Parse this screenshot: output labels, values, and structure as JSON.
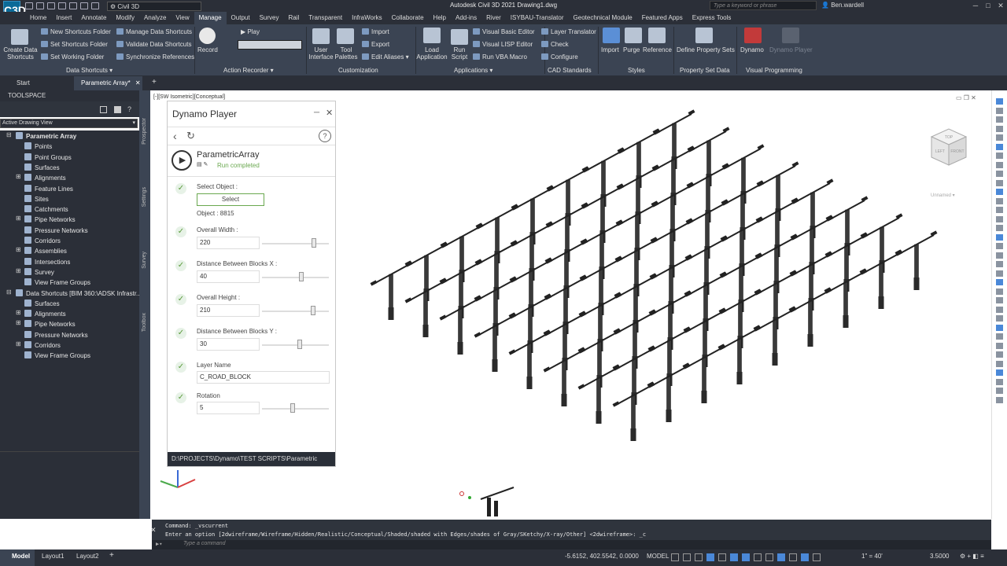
{
  "titlebar": {
    "logo": "C3D",
    "workspace": "Civil 3D",
    "title": "Autodesk Civil 3D 2021    Drawing1.dwg",
    "search_placeholder": "Type a keyword or phrase",
    "user": "Ben.wardell"
  },
  "menu_tabs": [
    "Home",
    "Insert",
    "Annotate",
    "Modify",
    "Analyze",
    "View",
    "Manage",
    "Output",
    "Survey",
    "Rail",
    "Transparent",
    "InfraWorks",
    "Collaborate",
    "Help",
    "Add-ins",
    "River",
    "ISYBAU-Translator",
    "Geotechnical Module",
    "Featured Apps",
    "Express Tools"
  ],
  "active_tab": "Manage",
  "ribbon": {
    "data_shortcuts": {
      "create": "Create Data Shortcuts",
      "items": [
        "New Shortcuts Folder",
        "Set Shortcuts Folder",
        "Set Working Folder",
        "Manage Data Shortcuts",
        "Validate Data Shortcuts",
        "Synchronize References"
      ],
      "label": "Data Shortcuts"
    },
    "action_recorder": {
      "record": "Record",
      "play": "Play",
      "label": "Action Recorder"
    },
    "customization": {
      "user_interface": "User Interface",
      "tool_palettes": "Tool Palettes",
      "import": "Import",
      "export": "Export",
      "edit_aliases": "Edit Aliases",
      "label": "Customization"
    },
    "applications": {
      "load": "Load Application",
      "run": "Run Script",
      "vb_editor": "Visual Basic Editor",
      "lisp_editor": "Visual LISP Editor",
      "vba_macro": "Run VBA Macro",
      "label": "Applications"
    },
    "cad_standards": {
      "layer_translator": "Layer Translator",
      "check": "Check",
      "configure": "Configure",
      "label": "CAD Standards"
    },
    "styles": {
      "import": "Import",
      "purge": "Purge",
      "reference": "Reference",
      "label": "Styles"
    },
    "property_set": {
      "define": "Define Property Sets",
      "label": "Property Set Data"
    },
    "visual_programming": {
      "dynamo": "Dynamo",
      "player": "Dynamo Player",
      "label": "Visual Programming"
    }
  },
  "doc_tabs": {
    "start": "Start",
    "current": "Parametric Array*"
  },
  "toolspace": {
    "header": "TOOLSPACE",
    "view": "Active Drawing View",
    "side_tabs": [
      "Prospector",
      "Settings",
      "Survey",
      "Toolbox"
    ],
    "tree": [
      {
        "label": "Parametric Array",
        "level": 0,
        "bold": true
      },
      {
        "label": "Points",
        "level": 1
      },
      {
        "label": "Point Groups",
        "level": 1
      },
      {
        "label": "Surfaces",
        "level": 1
      },
      {
        "label": "Alignments",
        "level": 1
      },
      {
        "label": "Feature Lines",
        "level": 1
      },
      {
        "label": "Sites",
        "level": 1
      },
      {
        "label": "Catchments",
        "level": 1
      },
      {
        "label": "Pipe Networks",
        "level": 1
      },
      {
        "label": "Pressure Networks",
        "level": 1
      },
      {
        "label": "Corridors",
        "level": 1
      },
      {
        "label": "Assemblies",
        "level": 1
      },
      {
        "label": "Intersections",
        "level": 1
      },
      {
        "label": "Survey",
        "level": 1
      },
      {
        "label": "View Frame Groups",
        "level": 1
      },
      {
        "label": "Data Shortcuts [BIM 360:\\ADSK Infrastr...",
        "level": 0
      },
      {
        "label": "Surfaces",
        "level": 1
      },
      {
        "label": "Alignments",
        "level": 1
      },
      {
        "label": "Pipe Networks",
        "level": 1
      },
      {
        "label": "Pressure Networks",
        "level": 1
      },
      {
        "label": "Corridors",
        "level": 1
      },
      {
        "label": "View Frame Groups",
        "level": 1
      }
    ]
  },
  "viewport_label": "[-][SW Isometric][Conceptual]",
  "viewcube": {
    "top": "TOP",
    "left": "LEFT",
    "front": "FRONT",
    "ucs": "Unnamed"
  },
  "dynamo": {
    "title": "Dynamo Player",
    "graph": "ParametricArray",
    "status": "Run completed",
    "inputs": {
      "select_label": "Select Object",
      "select_button": "Select",
      "object_id": "Object : 8815",
      "width_label": "Overall Width",
      "width_value": "220",
      "width_pos": 0.8,
      "dx_label": "Distance Between Blocks X",
      "dx_value": "40",
      "dx_pos": 0.6,
      "height_label": "Overall Height",
      "height_value": "210",
      "height_pos": 0.78,
      "dy_label": "Distance Between Blocks Y",
      "dy_value": "30",
      "dy_pos": 0.57,
      "layer_label": "Layer Name",
      "layer_value": "C_ROAD_BLOCK",
      "rotation_label": "Rotation",
      "rotation_value": "5",
      "rotation_pos": 0.45
    },
    "path": "D:\\PROJECTS\\Dynamo\\TEST SCRIPTS\\Parametric"
  },
  "command": {
    "line1": "Command: _vscurrent",
    "line2": "Enter an option [2dwireframe/Wireframe/Hidden/Realistic/Conceptual/Shaded/shaded with Edges/shades of Gray/SKetchy/X-ray/Other] <2dwireframe>: _c",
    "placeholder": "Type a command"
  },
  "status": {
    "tabs": [
      "Model",
      "Layout1",
      "Layout2"
    ],
    "coords": "-5.6152, 402.5542, 0.0000",
    "space": "MODEL",
    "scale": "1\" = 40'",
    "value": "3.5000"
  }
}
